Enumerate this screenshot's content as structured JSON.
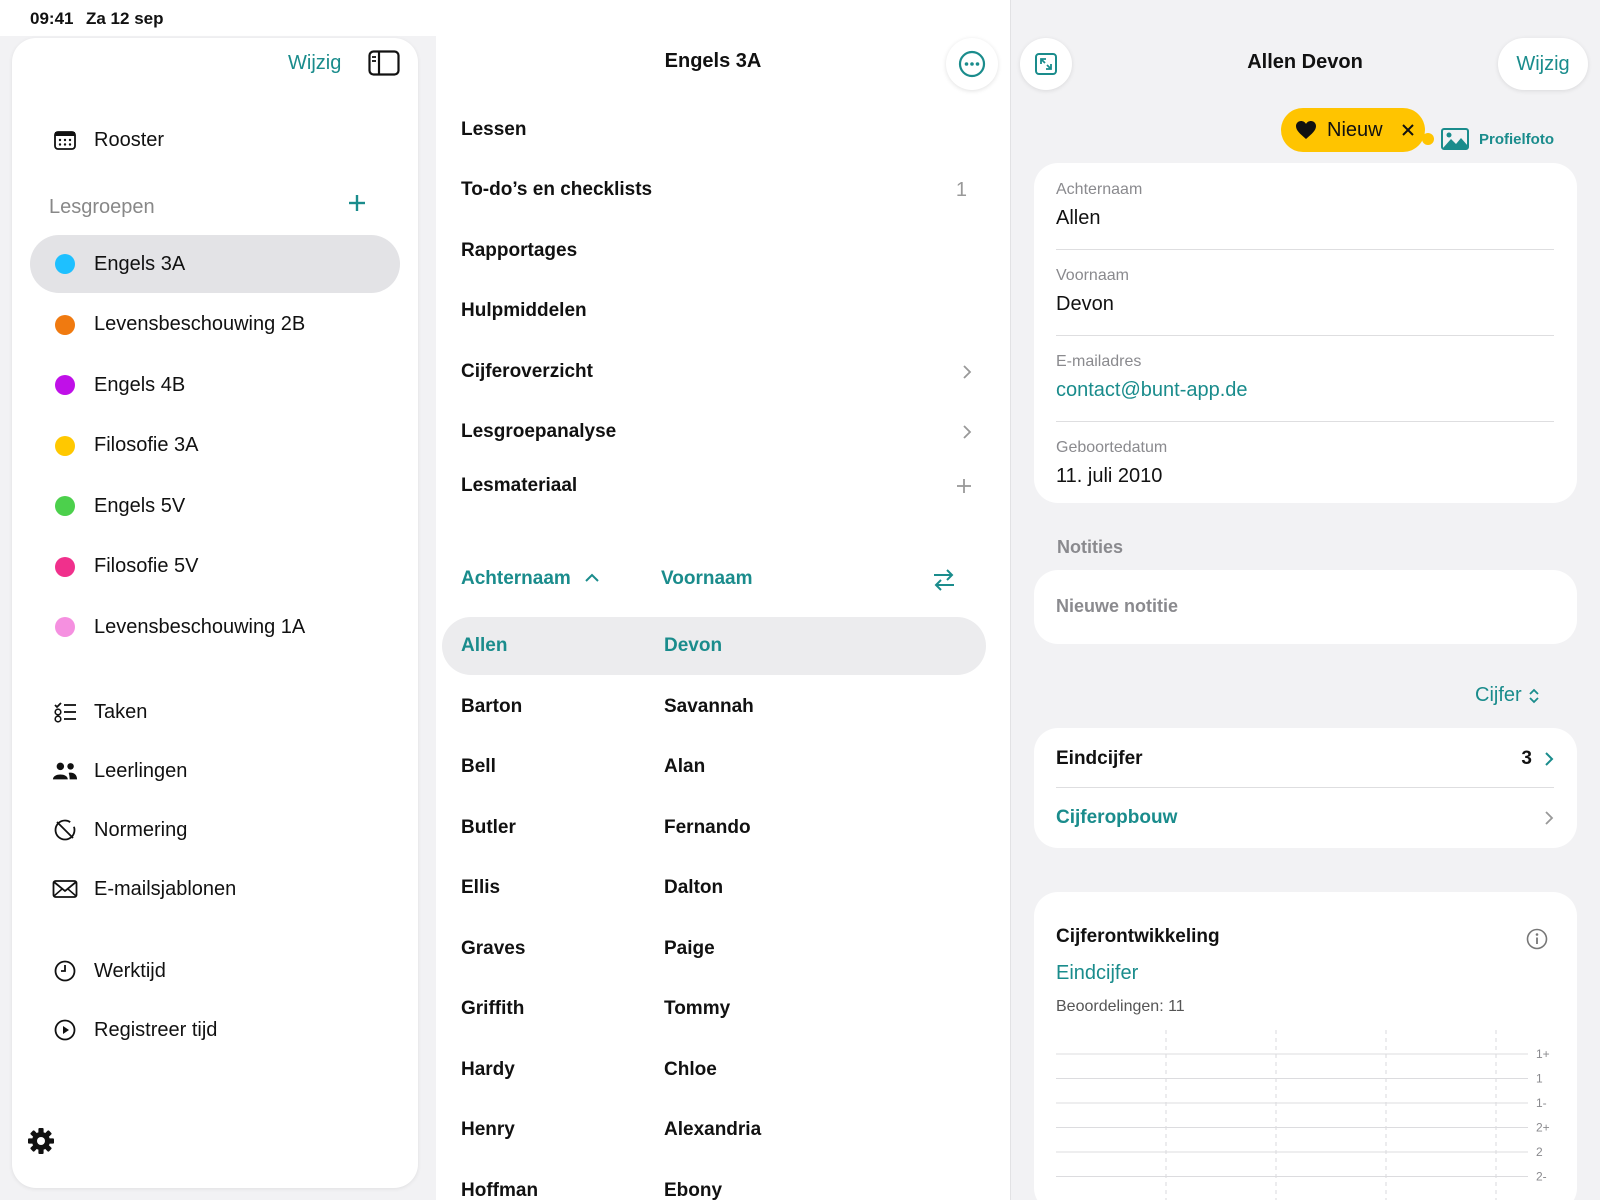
{
  "status": {
    "time": "09:41",
    "date": "Za 12 sep"
  },
  "sidebar": {
    "edit_label": "Wijzig",
    "schedule_label": "Rooster",
    "groups_title": "Lesgroepen",
    "groups": [
      {
        "label": "Engels 3A",
        "color": "#1ec0ff",
        "selected": true
      },
      {
        "label": "Levensbeschouwing 2B",
        "color": "#f07a10"
      },
      {
        "label": "Engels 4B",
        "color": "#c010e8"
      },
      {
        "label": "Filosofie 3A",
        "color": "#ffc800"
      },
      {
        "label": "Engels 5V",
        "color": "#4cd04c"
      },
      {
        "label": "Filosofie 5V",
        "color": "#f0308c"
      },
      {
        "label": "Levensbeschouwing 1A",
        "color": "#f590e0"
      }
    ],
    "items": [
      {
        "label": "Taken",
        "icon": "checklist-icon"
      },
      {
        "label": "Leerlingen",
        "icon": "people-icon"
      },
      {
        "label": "Normering",
        "icon": "norm-icon"
      },
      {
        "label": "E-mailsjablonen",
        "icon": "mail-icon"
      }
    ],
    "time_items": [
      {
        "label": "Werktijd",
        "icon": "clock-icon"
      },
      {
        "label": "Registreer tijd",
        "icon": "play-icon"
      }
    ]
  },
  "middle": {
    "title": "Engels 3A",
    "menu": [
      {
        "label": "Lessen",
        "right": ""
      },
      {
        "label": "To-do’s en checklists",
        "right": "1"
      },
      {
        "label": "Rapportages",
        "right": ""
      },
      {
        "label": "Hulpmiddelen",
        "right": ""
      },
      {
        "label": "Cijferoverzicht",
        "right": "chevron"
      },
      {
        "label": "Lesgroepanalyse",
        "right": "chevron"
      },
      {
        "label": "Lesmateriaal",
        "right": "plus"
      }
    ],
    "sort_lastname": "Achternaam",
    "sort_firstname": "Voornaam",
    "students": [
      {
        "last": "Allen",
        "first": "Devon",
        "selected": true
      },
      {
        "last": "Barton",
        "first": "Savannah"
      },
      {
        "last": "Bell",
        "first": "Alan"
      },
      {
        "last": "Butler",
        "first": "Fernando"
      },
      {
        "last": "Ellis",
        "first": "Dalton"
      },
      {
        "last": "Graves",
        "first": "Paige"
      },
      {
        "last": "Griffith",
        "first": "Tommy"
      },
      {
        "last": "Hardy",
        "first": "Chloe"
      },
      {
        "last": "Henry",
        "first": "Alexandria"
      },
      {
        "last": "Hoffman",
        "first": "Ebony"
      }
    ]
  },
  "detail": {
    "title": "Allen Devon",
    "edit_label": "Wijzig",
    "badge_label": "Nieuw",
    "profile_photo_label": "Profielfoto",
    "fields": {
      "lastname_label": "Achternaam",
      "lastname": "Allen",
      "firstname_label": "Voornaam",
      "firstname": "Devon",
      "email_label": "E-mailadres",
      "email": "contact@bunt-app.de",
      "birth_label": "Geboortedatum",
      "birth": "11. juli 2010"
    },
    "notes_title": "Notities",
    "notes_placeholder": "Nieuwe notitie",
    "grade_select": "Cijfer",
    "final_grade_label": "Eindcijfer",
    "final_grade_value": "3",
    "grade_build_label": "Cijferopbouw",
    "development": {
      "title": "Cijferontwikkeling",
      "subtitle": "Eindcijfer",
      "count": "Beoordelingen: 11"
    }
  },
  "chart_data": {
    "type": "line",
    "y_ticks": [
      "1+",
      "1",
      "1-",
      "2+",
      "2",
      "2-"
    ],
    "series": [],
    "grid": true
  },
  "colors": {
    "accent": "#1a8c8c",
    "badge": "#ffc400",
    "selected_bg": "#e3e3e6"
  }
}
